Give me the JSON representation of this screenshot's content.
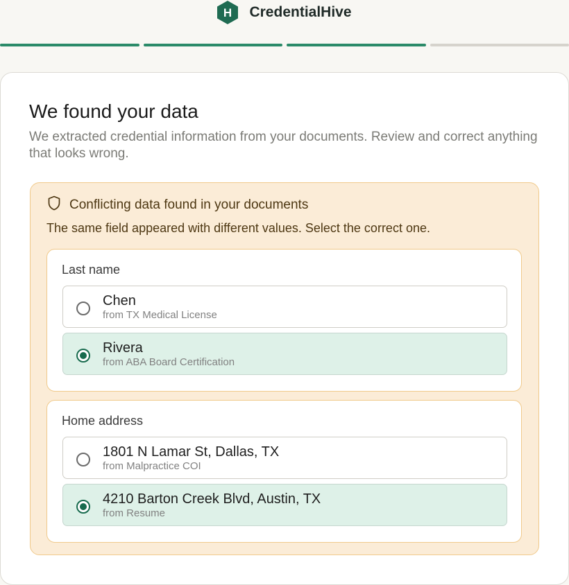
{
  "header": {
    "logo_letter": "H",
    "brand": "CredentialHive",
    "colors": {
      "brand": "#1f6b52",
      "accent": "#2b8a68"
    }
  },
  "progress": {
    "total_steps": 4,
    "completed_steps": 3
  },
  "page": {
    "title": "We found your data",
    "subtitle": "We extracted credential information from your documents. Review and correct anything that looks wrong."
  },
  "conflict": {
    "icon": "shield-icon",
    "title": "Conflicting data found in your documents",
    "description": "The same field appeared with different values. Select the correct one.",
    "fields": [
      {
        "label": "Last name",
        "options": [
          {
            "value": "Chen",
            "source": "from TX Medical License",
            "selected": false
          },
          {
            "value": "Rivera",
            "source": "from ABA Board Certification",
            "selected": true
          }
        ]
      },
      {
        "label": "Home address",
        "options": [
          {
            "value": "1801 N Lamar St, Dallas, TX",
            "source": "from Malpractice COI",
            "selected": false
          },
          {
            "value": "4210 Barton Creek Blvd, Austin, TX",
            "source": "from Resume",
            "selected": true
          }
        ]
      }
    ]
  }
}
